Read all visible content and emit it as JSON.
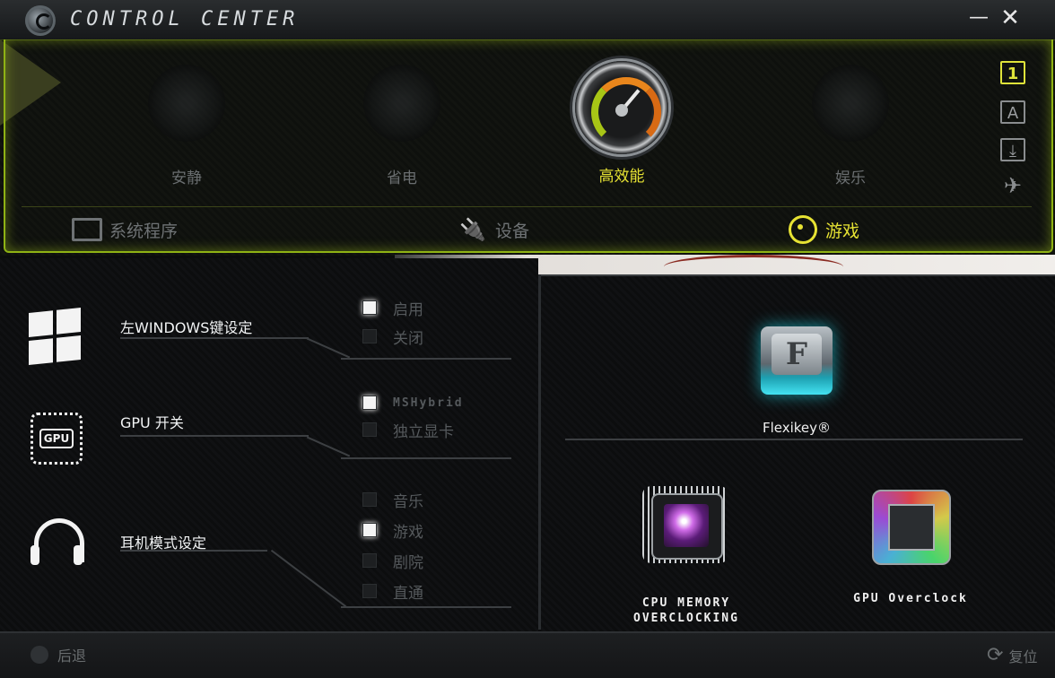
{
  "window": {
    "title": "Control Center"
  },
  "modes": [
    {
      "label": "安静",
      "icon": "speaker-icon"
    },
    {
      "label": "省电",
      "icon": "fan-icon"
    },
    {
      "label": "高效能",
      "icon": "speedometer-icon",
      "gauge": {
        "min": "MIN",
        "max": "MAX"
      }
    },
    {
      "label": "娱乐",
      "icon": "crosshair-icon"
    }
  ],
  "side_icons": {
    "profile": "1",
    "profile_a": "A"
  },
  "categories": [
    {
      "label": "系统程序",
      "icon": "monitor-icon"
    },
    {
      "label": "设备",
      "icon": "plug-icon"
    },
    {
      "label": "游戏",
      "icon": "steering-wheel-icon"
    }
  ],
  "settings": {
    "win_key": {
      "title": "左WINDOWS键设定",
      "options": [
        "启用",
        "关闭"
      ],
      "selected": "启用"
    },
    "gpu_switch": {
      "title": "GPU 开关",
      "icon_text": "GPU",
      "options": [
        "MSHybrid",
        "独立显卡"
      ],
      "selected": "MSHybrid"
    },
    "headset": {
      "title": "耳机模式设定",
      "options": [
        "音乐",
        "游戏",
        "剧院",
        "直通"
      ],
      "selected": "游戏"
    }
  },
  "tools": {
    "flexikey": {
      "label": "Flexikey®",
      "key_letter": "F"
    },
    "cpu_oc": {
      "label_line1": "CPU MEMORY",
      "label_line2": "OVERCLOCKING"
    },
    "gpu_oc": {
      "label": "GPU Overclock"
    }
  },
  "footer": {
    "back": "后退",
    "reset": "复位"
  },
  "colors": {
    "accent": "#e6e233",
    "border": "#8fb214"
  }
}
